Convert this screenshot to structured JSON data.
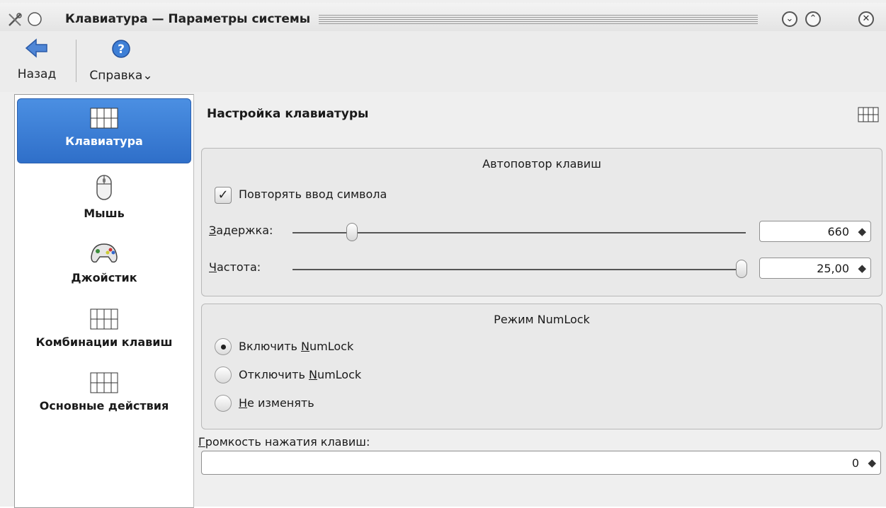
{
  "window": {
    "title": "Клавиатура — Параметры системы"
  },
  "toolbar": {
    "back_label": "Назад",
    "help_label": "Справка"
  },
  "sidebar": {
    "items": [
      {
        "label": "Клавиатура",
        "icon": "keyboard-icon",
        "active": true
      },
      {
        "label": "Мышь",
        "icon": "mouse-icon",
        "active": false
      },
      {
        "label": "Джойстик",
        "icon": "gamepad-icon",
        "active": false
      },
      {
        "label": "Комбинации клавиш",
        "icon": "keyboard-icon",
        "active": false
      },
      {
        "label": "Основные действия",
        "icon": "keyboard-icon",
        "active": false
      }
    ]
  },
  "main": {
    "heading": "Настройка клавиатуры",
    "repeat_group": {
      "title": "Автоповтор клавиш",
      "repeat_checkbox": {
        "label": "Повторять ввод символа",
        "checked": true
      },
      "delay": {
        "label_mnemonic": "З",
        "label_rest": "адержка:",
        "value": "660",
        "slider_fraction": 0.12
      },
      "rate": {
        "label_mnemonic": "Ч",
        "label_rest": "астота:",
        "value": "25,00",
        "slider_fraction": 0.99
      }
    },
    "numlock_group": {
      "title": "Режим NumLock",
      "options": [
        {
          "pre": "Включить ",
          "mn": "N",
          "post": "umLock",
          "selected": true
        },
        {
          "pre": "Отключить ",
          "mn": "N",
          "post": "umLock",
          "selected": false
        },
        {
          "pre": "",
          "mn": "Н",
          "post": "е изменять",
          "selected": false
        }
      ]
    },
    "volume": {
      "label_mnemonic": "Г",
      "label_rest": "ромкость нажатия клавиш:",
      "value": "0"
    }
  }
}
